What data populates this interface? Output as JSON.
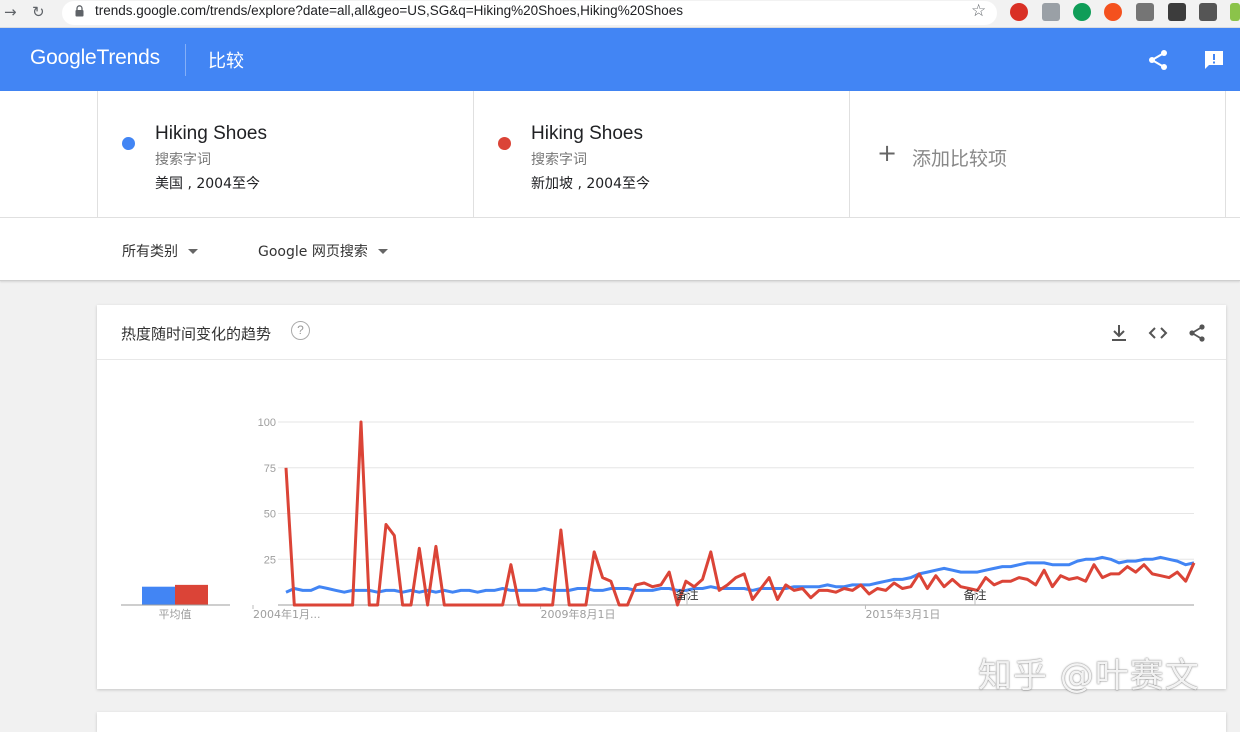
{
  "browser": {
    "url": "trends.google.com/trends/explore?date=all,all&geo=US,SG&q=Hiking%20Shoes,Hiking%20Shoes"
  },
  "header": {
    "logo_google": "Google",
    "logo_trends": "Trends",
    "title": "比较"
  },
  "terms": [
    {
      "name": "Hiking Shoes",
      "kind": "搜索字词",
      "meta": "美国 , 2004至今",
      "color": "#4285f4"
    },
    {
      "name": "Hiking Shoes",
      "kind": "搜索字词",
      "meta": "新加坡 , 2004至今",
      "color": "#db4437"
    }
  ],
  "add_term": {
    "plus": "+",
    "label": "添加比较项"
  },
  "filters": {
    "category": "所有类别",
    "search_type": "Google 网页搜索"
  },
  "card": {
    "title": "热度随时间变化的趋势",
    "help": "?",
    "avg_label": "平均值",
    "note_label": "备注"
  },
  "chart_data": {
    "type": "line",
    "ylim": [
      0,
      100
    ],
    "y_ticks": [
      "100",
      "75",
      "50",
      "25"
    ],
    "x_tick_labels": [
      "2004年1月...",
      "2009年8月1日",
      "2015年3月1日"
    ],
    "annotations": [
      "备注",
      "备注"
    ],
    "averages": [
      10,
      11
    ],
    "series": [
      {
        "color": "#4285f4",
        "values": [
          7,
          9,
          8,
          8,
          10,
          9,
          8,
          7,
          8,
          8,
          8,
          7,
          8,
          8,
          7,
          8,
          7,
          8,
          7,
          8,
          7,
          8,
          8,
          7,
          8,
          8,
          9,
          8,
          8,
          8,
          8,
          9,
          8,
          8,
          8,
          9,
          9,
          8,
          8,
          9,
          9,
          9,
          8,
          8,
          8,
          9,
          9,
          8,
          8,
          9,
          9,
          10,
          9,
          9,
          9,
          9,
          8,
          9,
          9,
          9,
          9,
          10,
          10,
          10,
          10,
          11,
          10,
          10,
          11,
          11,
          11,
          12,
          13,
          14,
          14,
          15,
          17,
          18,
          19,
          20,
          19,
          18,
          18,
          18,
          19,
          20,
          21,
          21,
          22,
          23,
          23,
          23,
          22,
          22,
          22,
          24,
          25,
          25,
          26,
          25,
          23,
          24,
          24,
          25,
          25,
          26,
          25,
          24,
          22,
          23
        ]
      },
      {
        "color": "#db4437",
        "values": [
          75,
          0,
          0,
          0,
          0,
          0,
          0,
          0,
          0,
          100,
          0,
          0,
          44,
          38,
          0,
          0,
          31,
          0,
          32,
          0,
          0,
          0,
          0,
          0,
          0,
          0,
          0,
          22,
          0,
          0,
          0,
          0,
          0,
          41,
          0,
          0,
          0,
          29,
          15,
          13,
          0,
          0,
          11,
          12,
          10,
          11,
          18,
          0,
          13,
          10,
          14,
          29,
          8,
          11,
          15,
          17,
          3,
          9,
          15,
          3,
          11,
          8,
          9,
          4,
          8,
          8,
          7,
          9,
          8,
          11,
          6,
          9,
          8,
          12,
          9,
          10,
          17,
          9,
          16,
          10,
          14,
          10,
          9,
          8,
          15,
          11,
          13,
          13,
          15,
          14,
          11,
          19,
          10,
          16,
          14,
          15,
          13,
          22,
          15,
          17,
          17,
          21,
          18,
          22,
          17,
          16,
          15,
          18,
          13,
          23
        ]
      }
    ]
  }
}
